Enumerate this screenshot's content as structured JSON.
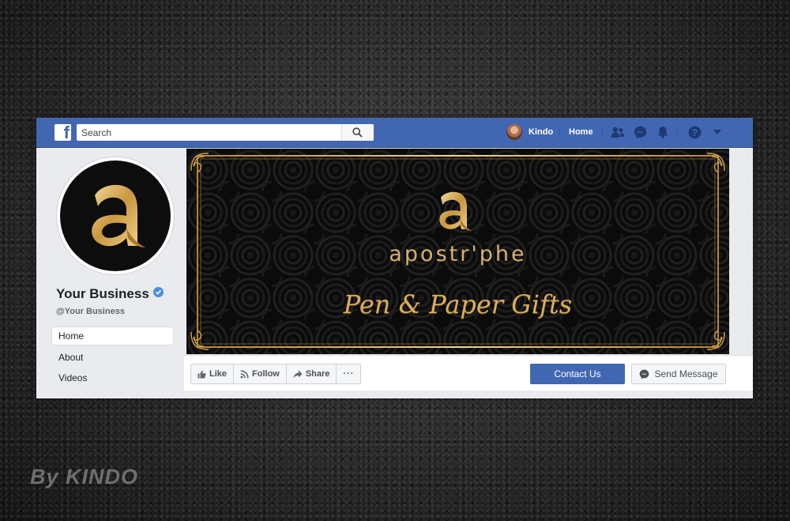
{
  "watermark": "By KINDO",
  "topbar": {
    "search_placeholder": "Search",
    "user_name": "Kindo",
    "home_label": "Home"
  },
  "page": {
    "name": "Your Business",
    "handle": "@Your Business"
  },
  "sidebar": {
    "items": [
      {
        "label": "Home",
        "active": true
      },
      {
        "label": "About",
        "active": false
      },
      {
        "label": "Videos",
        "active": false
      }
    ]
  },
  "cover": {
    "brand_name": "apostr'phe",
    "tagline": "Pen & Paper Gifts"
  },
  "actions": {
    "like_label": "Like",
    "follow_label": "Follow",
    "share_label": "Share",
    "more_label": "···",
    "contact_label": "Contact Us",
    "message_label": "Send Message"
  },
  "colors": {
    "facebook_blue": "#4267b2",
    "gold": "#d4a95a",
    "cover_background": "#0b0b0b"
  }
}
